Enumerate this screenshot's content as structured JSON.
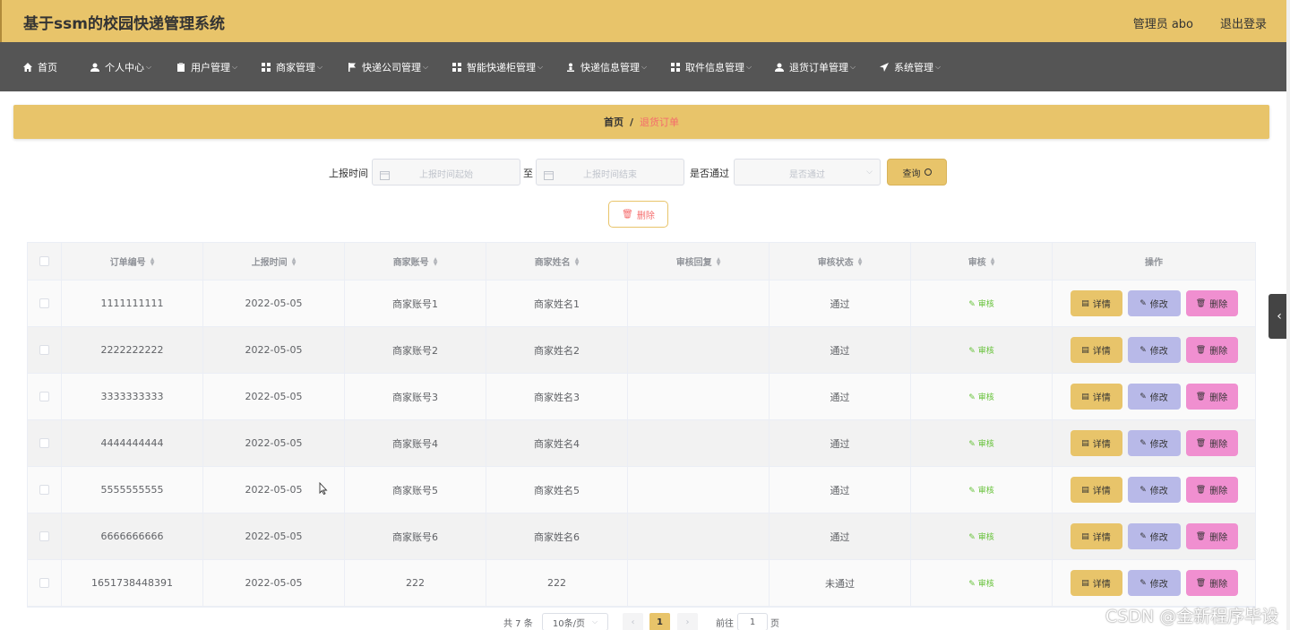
{
  "app": {
    "title": "基于ssm的校园快递管理系统",
    "user_label": "管理员 abo",
    "logout_label": "退出登录"
  },
  "nav": [
    {
      "label": "首页",
      "icon": "home-icon",
      "chevron": false
    },
    {
      "label": "个人中心",
      "icon": "user-icon",
      "chevron": true
    },
    {
      "label": "用户管理",
      "icon": "clipboard-icon",
      "chevron": true
    },
    {
      "label": "商家管理",
      "icon": "grid-icon",
      "chevron": true
    },
    {
      "label": "快递公司管理",
      "icon": "flag-icon",
      "chevron": true
    },
    {
      "label": "智能快递柜管理",
      "icon": "grid-icon",
      "chevron": true
    },
    {
      "label": "快递信息管理",
      "icon": "person-stand-icon",
      "chevron": true
    },
    {
      "label": "取件信息管理",
      "icon": "grid-icon",
      "chevron": true
    },
    {
      "label": "退货订单管理",
      "icon": "user-icon",
      "chevron": true
    },
    {
      "label": "系统管理",
      "icon": "send-icon",
      "chevron": true
    }
  ],
  "breadcrumb": {
    "home": "首页",
    "separator": "/",
    "current": "退货订单"
  },
  "search": {
    "time_label": "上报时间",
    "start_placeholder": "上报时间起始",
    "to_label": "至",
    "end_placeholder": "上报时间结束",
    "pass_label": "是否通过",
    "pass_placeholder": "是否通过",
    "query_label": "查询"
  },
  "bulk_delete_label": "删除",
  "table": {
    "headers": [
      "订单编号",
      "上报时间",
      "商家账号",
      "商家姓名",
      "审核回复",
      "审核状态",
      "审核",
      "操作"
    ],
    "audit_link": "审核",
    "actions": {
      "detail": "详情",
      "edit": "修改",
      "delete": "删除"
    },
    "rows": [
      {
        "order_no": "1111111111",
        "report_time": "2022-05-05",
        "merchant_account": "商家账号1",
        "merchant_name": "商家姓名1",
        "reply": "",
        "status": "通过"
      },
      {
        "order_no": "2222222222",
        "report_time": "2022-05-05",
        "merchant_account": "商家账号2",
        "merchant_name": "商家姓名2",
        "reply": "",
        "status": "通过"
      },
      {
        "order_no": "3333333333",
        "report_time": "2022-05-05",
        "merchant_account": "商家账号3",
        "merchant_name": "商家姓名3",
        "reply": "",
        "status": "通过"
      },
      {
        "order_no": "4444444444",
        "report_time": "2022-05-05",
        "merchant_account": "商家账号4",
        "merchant_name": "商家姓名4",
        "reply": "",
        "status": "通过"
      },
      {
        "order_no": "5555555555",
        "report_time": "2022-05-05",
        "merchant_account": "商家账号5",
        "merchant_name": "商家姓名5",
        "reply": "",
        "status": "通过"
      },
      {
        "order_no": "6666666666",
        "report_time": "2022-05-05",
        "merchant_account": "商家账号6",
        "merchant_name": "商家姓名6",
        "reply": "",
        "status": "通过"
      },
      {
        "order_no": "1651738448391",
        "report_time": "2022-05-05",
        "merchant_account": "222",
        "merchant_name": "222",
        "reply": "",
        "status": "未通过"
      }
    ]
  },
  "pagination": {
    "total": "共 7 条",
    "page_size": "10条/页",
    "current_page": "1",
    "goto_label": "前往",
    "goto_value": "1",
    "page_suffix": "页"
  },
  "watermark": "CSDN @金新程序毕设",
  "colors": {
    "accent": "#e8c46a",
    "nav_bg": "#555555",
    "edit_btn": "#b8b9e8",
    "delete_btn": "#f08fd0",
    "audit_link": "#67c23a",
    "breadcrumb_current": "#f56c6c"
  }
}
